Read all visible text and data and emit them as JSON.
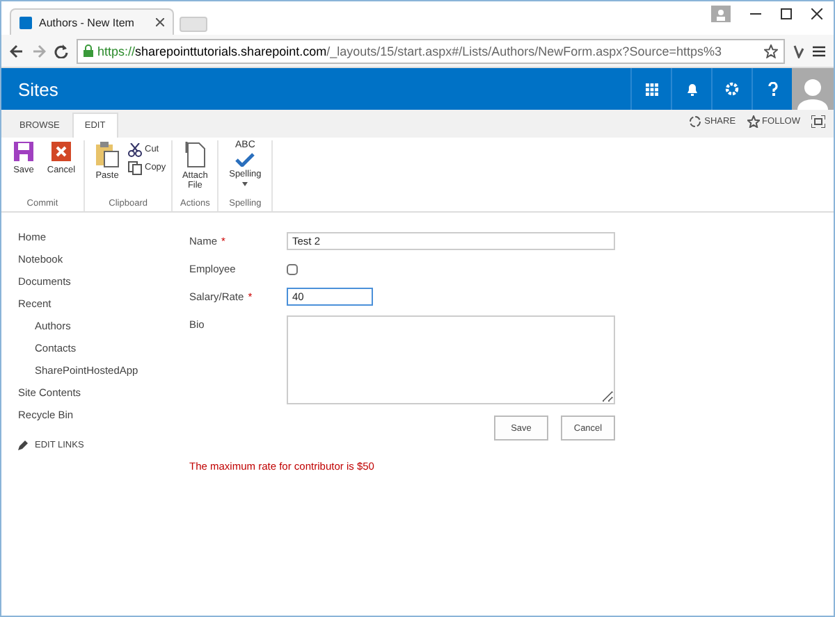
{
  "browser": {
    "tab_title": "Authors - New Item",
    "url_scheme": "https://",
    "url_host": "sharepointtutorials.sharepoint.com",
    "url_path": "/_layouts/15/start.aspx#/Lists/Authors/NewForm.aspx?Source=https%3"
  },
  "suite_bar": {
    "title": "Sites"
  },
  "ribbon_tabs": [
    {
      "label": "BROWSE",
      "selected": false
    },
    {
      "label": "EDIT",
      "selected": true
    }
  ],
  "ribbon_actions": [
    "SHARE",
    "FOLLOW"
  ],
  "ribbon_groups": [
    {
      "name": "Commit",
      "buttons": [
        {
          "label": "Save",
          "kind": "save"
        },
        {
          "label": "Cancel",
          "kind": "cancel"
        }
      ]
    },
    {
      "name": "Clipboard",
      "buttons": [
        {
          "label": "Paste",
          "kind": "paste"
        },
        {
          "label": "Cut",
          "kind": "cut"
        },
        {
          "label": "Copy",
          "kind": "copy"
        }
      ]
    },
    {
      "name": "Actions",
      "buttons": [
        {
          "label": "Attach File",
          "kind": "attach"
        }
      ]
    },
    {
      "name": "Spelling",
      "buttons": [
        {
          "label": "Spelling",
          "kind": "spelling",
          "abc": "ABC"
        }
      ]
    }
  ],
  "nav": [
    {
      "label": "Home"
    },
    {
      "label": "Notebook"
    },
    {
      "label": "Documents"
    },
    {
      "label": "Recent",
      "children": [
        {
          "label": "Authors"
        },
        {
          "label": "Contacts"
        },
        {
          "label": "SharePointHostedApp"
        }
      ]
    },
    {
      "label": "Site Contents"
    },
    {
      "label": "Recycle Bin"
    }
  ],
  "edit_links": "EDIT LINKS",
  "fields": [
    {
      "label": "Name",
      "required": true,
      "kind": "text",
      "value": "Test 2",
      "focused": false
    },
    {
      "label": "Employee",
      "required": false,
      "kind": "checkbox",
      "checked": false
    },
    {
      "label": "Salary/Rate",
      "required": true,
      "kind": "short",
      "value": "40",
      "focused": true
    },
    {
      "label": "Bio",
      "required": false,
      "kind": "textarea"
    }
  ],
  "buttons": [
    "Save",
    "Cancel"
  ],
  "error": "The maximum rate for contributor is $50",
  "required_mark": "*"
}
